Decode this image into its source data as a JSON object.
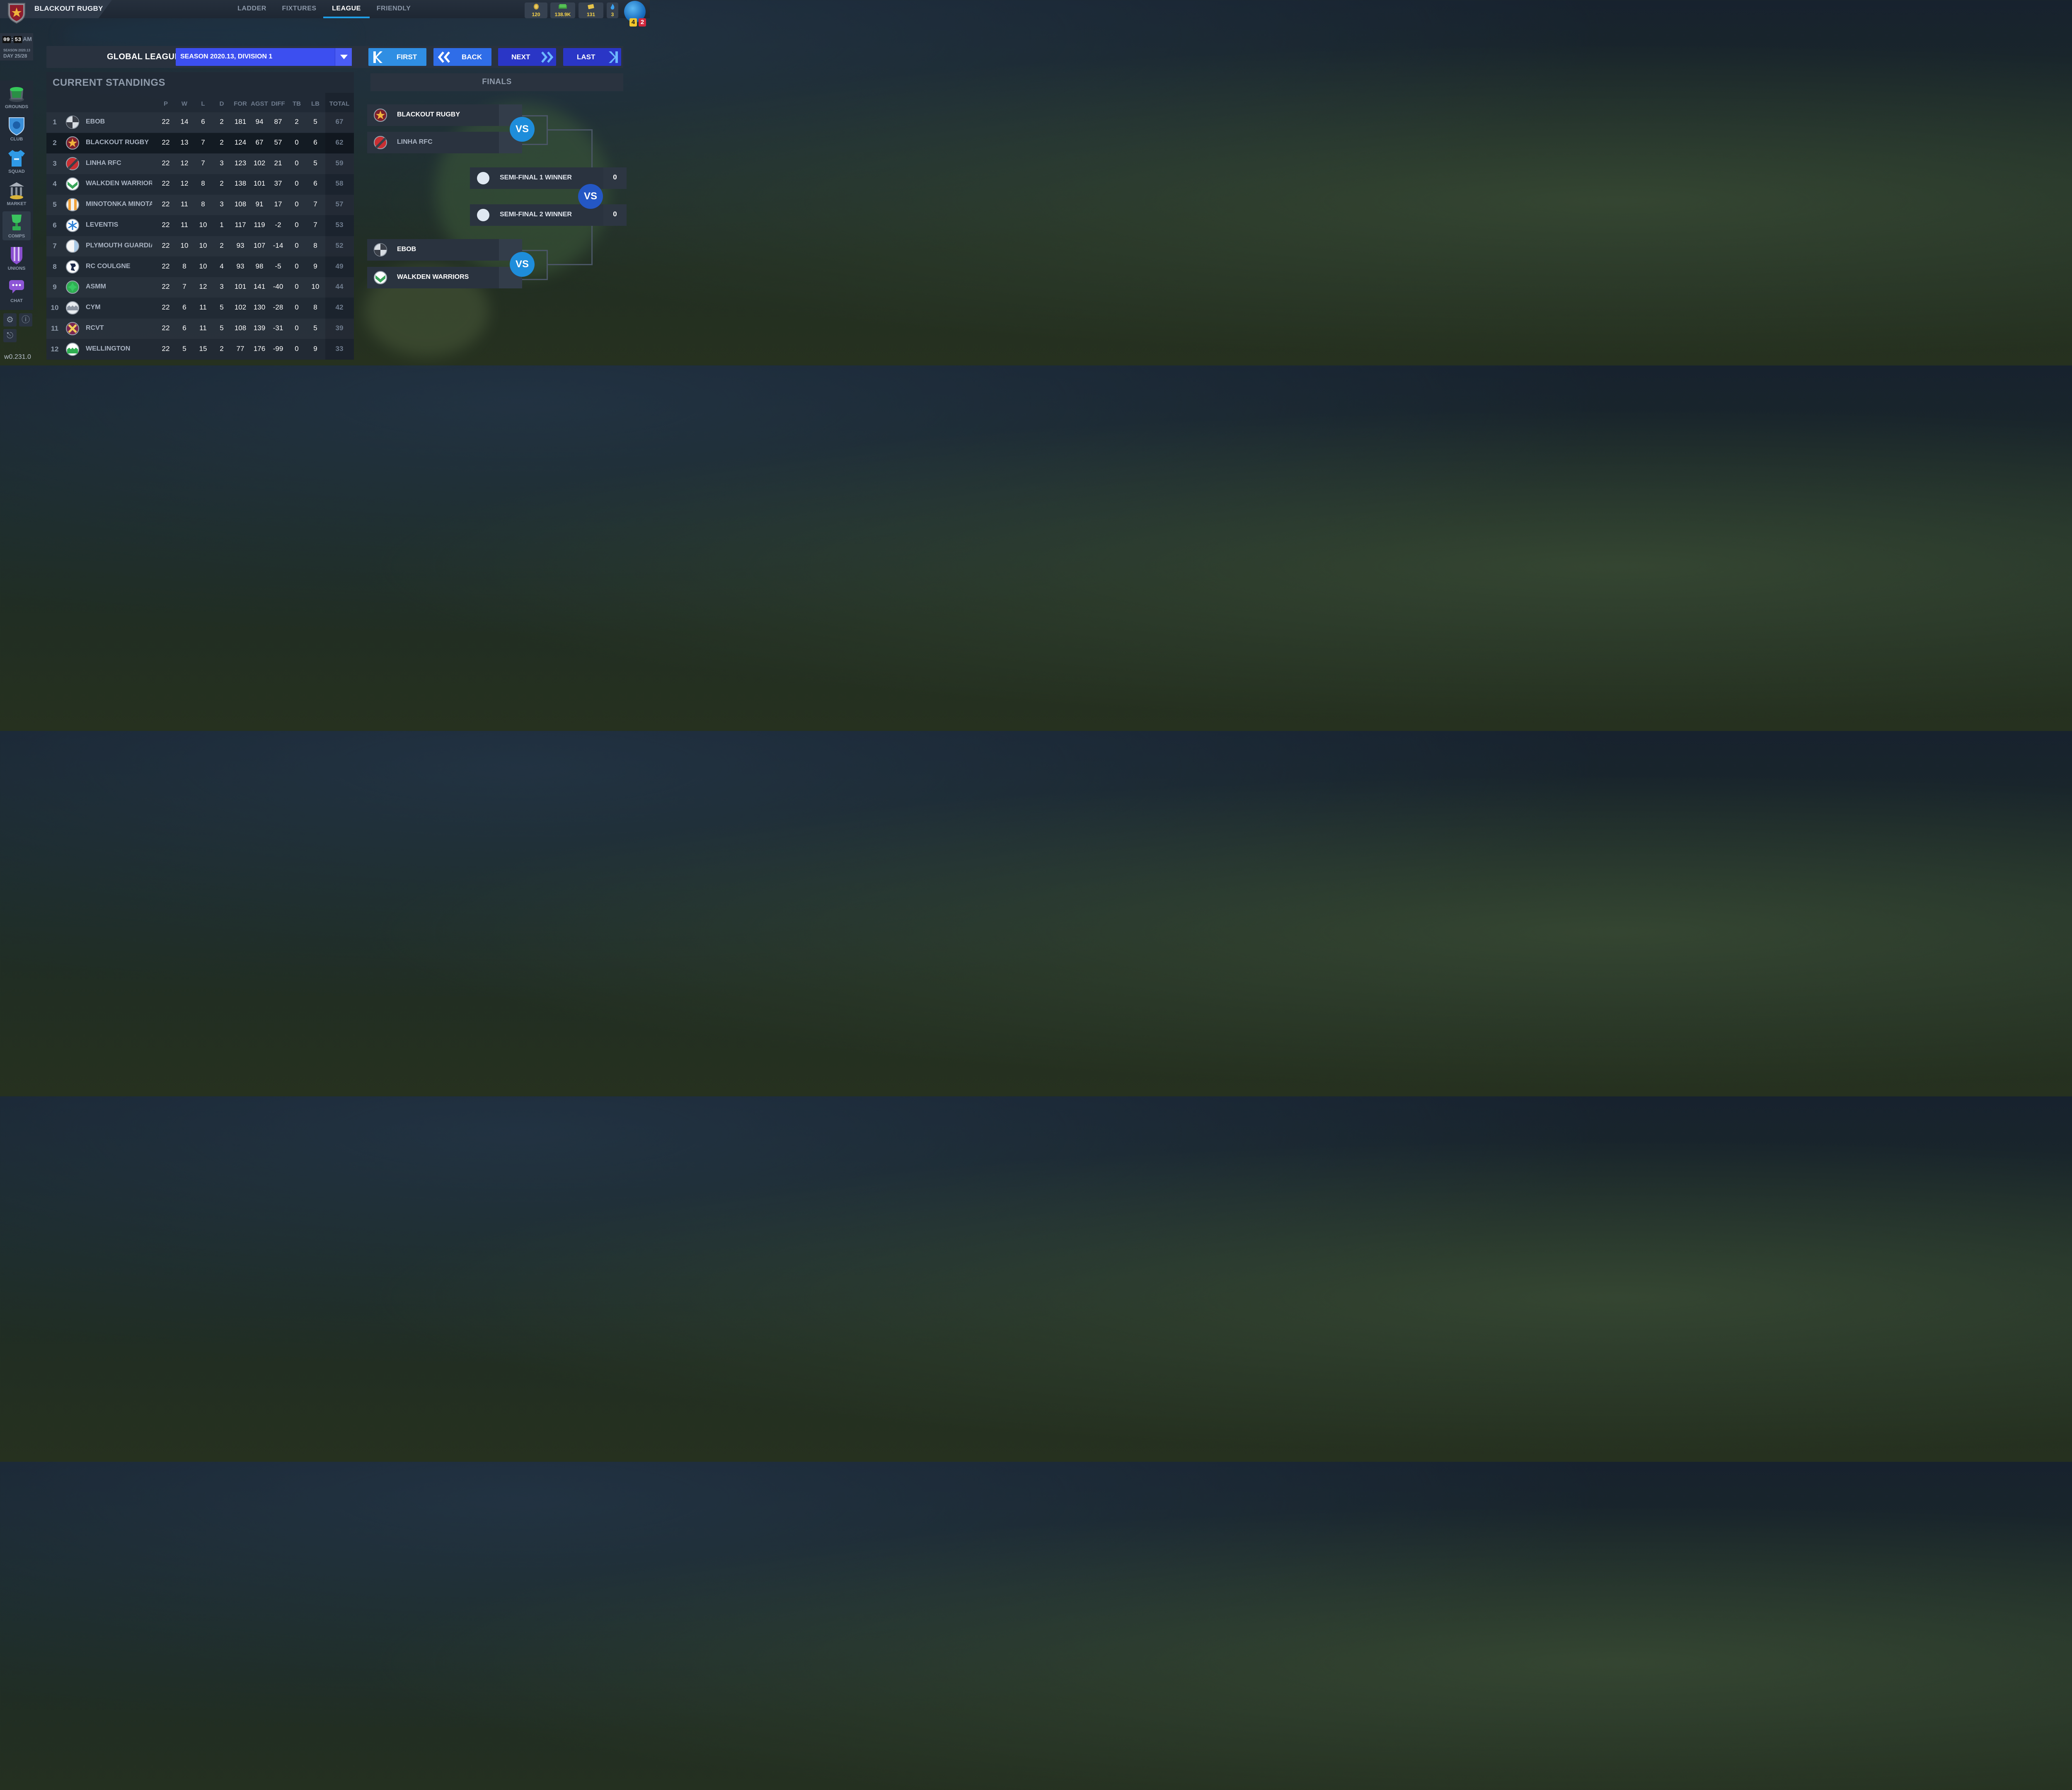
{
  "app": {
    "team_name": "BLACKOUT RUGBY",
    "tabs": [
      "LADDER",
      "FIXTURES",
      "LEAGUE",
      "FRIENDLY"
    ],
    "active_tab": "LEAGUE",
    "currencies": [
      {
        "icon": "coin-icon",
        "value": "120"
      },
      {
        "icon": "cash-icon",
        "value": "138.9K"
      },
      {
        "icon": "ticket-icon",
        "value": "131"
      },
      {
        "icon": "flame-icon",
        "value": "3"
      }
    ],
    "badges": {
      "yellow": "4",
      "red": "2"
    },
    "version": "w0.231.0"
  },
  "clock": {
    "hh": "09",
    "mm": "53",
    "ampm": "AM",
    "season": "SEASON 2020.13",
    "day": "DAY 25/28"
  },
  "sidebar": {
    "items": [
      {
        "label": "GROUNDS",
        "icon": "stadium-icon"
      },
      {
        "label": "CLUB",
        "icon": "club-crest-icon"
      },
      {
        "label": "SQUAD",
        "icon": "jersey-icon"
      },
      {
        "label": "MARKET",
        "icon": "bank-icon"
      },
      {
        "label": "COMPS",
        "icon": "trophy-icon"
      },
      {
        "label": "UNIONS",
        "icon": "shield-banner-icon"
      },
      {
        "label": "CHAT",
        "icon": "chat-icon"
      }
    ],
    "active": "COMPS"
  },
  "league": {
    "title": "GLOBAL LEAGUE",
    "season_selected": "SEASON 2020.13, DIVISION 1",
    "nav": {
      "first": "FIRST",
      "back": "BACK",
      "next": "NEXT",
      "last": "LAST"
    }
  },
  "standings": {
    "title": "CURRENT STANDINGS",
    "columns": [
      "P",
      "W",
      "L",
      "D",
      "FOR",
      "AGST",
      "DIFF",
      "TB",
      "LB",
      "TOTAL"
    ],
    "rows": [
      {
        "rank": "1",
        "name": "EBOB",
        "logo": "quartered-grey",
        "P": "22",
        "W": "14",
        "L": "6",
        "D": "2",
        "FOR": "181",
        "AGST": "94",
        "DIFF": "87",
        "TB": "2",
        "LB": "5",
        "TOTAL": "67"
      },
      {
        "rank": "2",
        "name": "BLACKOUT RUGBY",
        "logo": "star-maroon",
        "P": "22",
        "W": "13",
        "L": "7",
        "D": "2",
        "FOR": "124",
        "AGST": "67",
        "DIFF": "57",
        "TB": "0",
        "LB": "6",
        "TOTAL": "62"
      },
      {
        "rank": "3",
        "name": "LINHA RFC",
        "logo": "diagonal-red",
        "P": "22",
        "W": "12",
        "L": "7",
        "D": "3",
        "FOR": "123",
        "AGST": "102",
        "DIFF": "21",
        "TB": "0",
        "LB": "5",
        "TOTAL": "59"
      },
      {
        "rank": "4",
        "name": "WALKDEN WARRIORS",
        "logo": "chevron-green",
        "P": "22",
        "W": "12",
        "L": "8",
        "D": "2",
        "FOR": "138",
        "AGST": "101",
        "DIFF": "37",
        "TB": "0",
        "LB": "6",
        "TOTAL": "58"
      },
      {
        "rank": "5",
        "name": "MINOTONKA MINOTA",
        "logo": "stripe-orange",
        "P": "22",
        "W": "11",
        "L": "8",
        "D": "3",
        "FOR": "108",
        "AGST": "91",
        "DIFF": "17",
        "TB": "0",
        "LB": "7",
        "TOTAL": "57"
      },
      {
        "rank": "6",
        "name": "LEVENTIS",
        "logo": "asterisk-blue",
        "P": "22",
        "W": "11",
        "L": "10",
        "D": "1",
        "FOR": "117",
        "AGST": "119",
        "DIFF": "-2",
        "TB": "0",
        "LB": "7",
        "TOTAL": "53"
      },
      {
        "rank": "7",
        "name": "PLYMOUTH GUARDIA",
        "logo": "half-white",
        "P": "22",
        "W": "10",
        "L": "10",
        "D": "2",
        "FOR": "93",
        "AGST": "107",
        "DIFF": "-14",
        "TB": "0",
        "LB": "8",
        "TOTAL": "52"
      },
      {
        "rank": "8",
        "name": "RC COULGNE",
        "logo": "beast-navy",
        "P": "22",
        "W": "8",
        "L": "10",
        "D": "4",
        "FOR": "93",
        "AGST": "98",
        "DIFF": "-5",
        "TB": "0",
        "LB": "9",
        "TOTAL": "49"
      },
      {
        "rank": "9",
        "name": "ASMM",
        "logo": "clover-green",
        "P": "22",
        "W": "7",
        "L": "12",
        "D": "3",
        "FOR": "101",
        "AGST": "141",
        "DIFF": "-40",
        "TB": "0",
        "LB": "10",
        "TOTAL": "44"
      },
      {
        "rank": "10",
        "name": "CYM",
        "logo": "waves-grey",
        "P": "22",
        "W": "6",
        "L": "11",
        "D": "5",
        "FOR": "102",
        "AGST": "130",
        "DIFF": "-28",
        "TB": "0",
        "LB": "8",
        "TOTAL": "42"
      },
      {
        "rank": "11",
        "name": "RCVT",
        "logo": "cross-purple",
        "P": "22",
        "W": "6",
        "L": "11",
        "D": "5",
        "FOR": "108",
        "AGST": "139",
        "DIFF": "-31",
        "TB": "0",
        "LB": "5",
        "TOTAL": "39"
      },
      {
        "rank": "12",
        "name": "WELLINGTON",
        "logo": "waves-green",
        "P": "22",
        "W": "5",
        "L": "15",
        "D": "2",
        "FOR": "77",
        "AGST": "176",
        "DIFF": "-99",
        "TB": "0",
        "LB": "9",
        "TOTAL": "33"
      }
    ]
  },
  "finals": {
    "title": "FINALS",
    "vs_label": "VS",
    "semi1": {
      "home": "BLACKOUT RUGBY",
      "away": "LINHA RFC"
    },
    "semi2": {
      "home": "EBOB",
      "away": "WALKDEN WARRIORS"
    },
    "final": {
      "home": "SEMI-FINAL 1 WINNER",
      "home_score": "0",
      "away": "SEMI-FINAL 2 WINNER",
      "away_score": "0"
    }
  },
  "colors": {
    "accent": "#1f9ee6",
    "select": "#3c4ff0",
    "vs": "#1e8ddb"
  }
}
